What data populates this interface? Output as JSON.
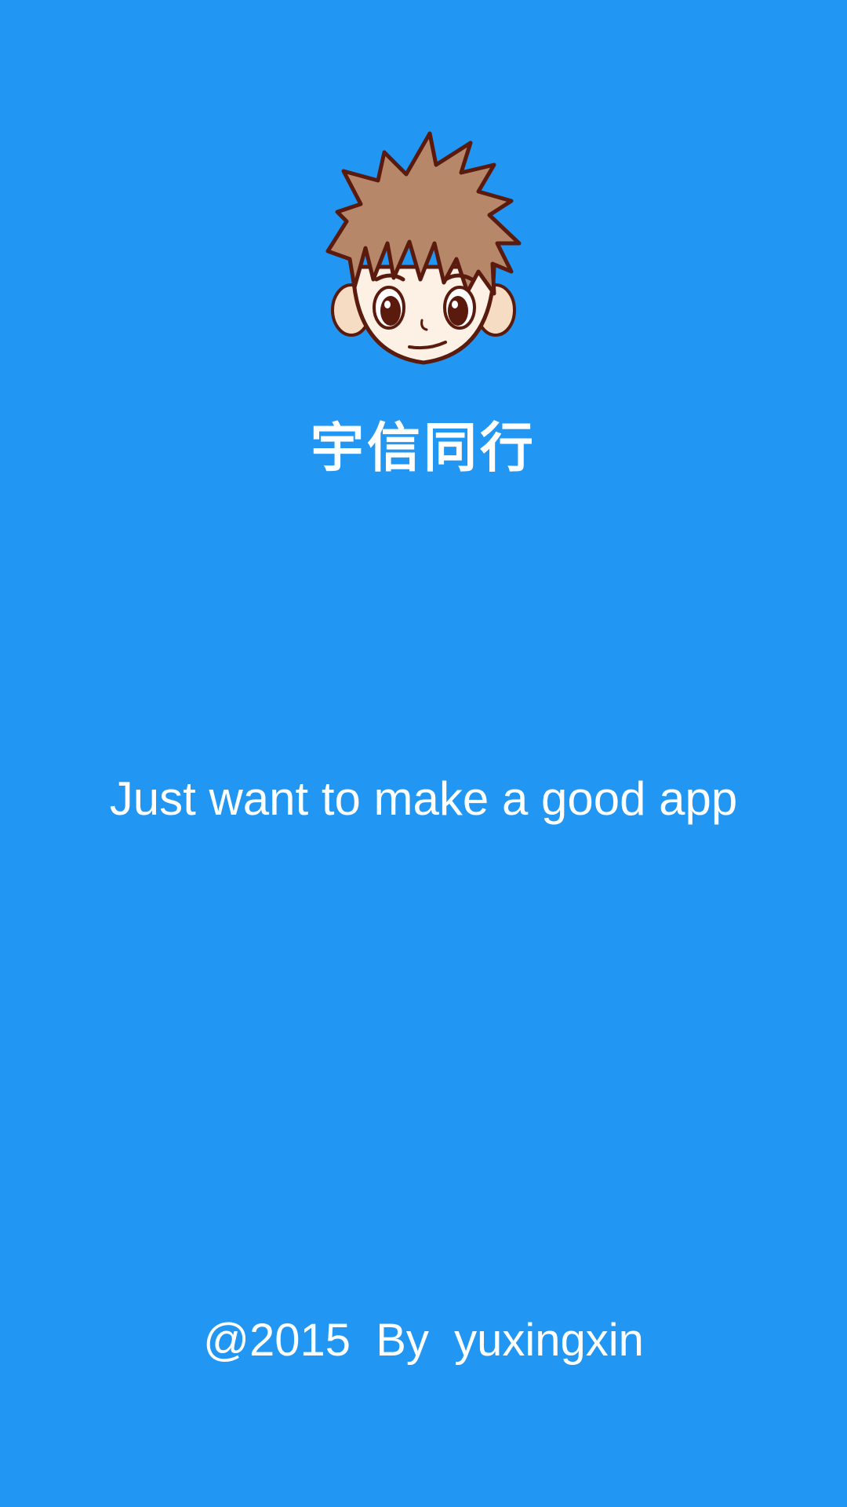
{
  "app": {
    "title": "宇信同行",
    "logo_icon": "cartoon-boy-avatar-icon",
    "background_color": "#2196f3",
    "text_color": "#ffffff"
  },
  "slogan": "Just want to make a good app",
  "footer": {
    "copyright": "@2015  By  yuxingxin"
  }
}
